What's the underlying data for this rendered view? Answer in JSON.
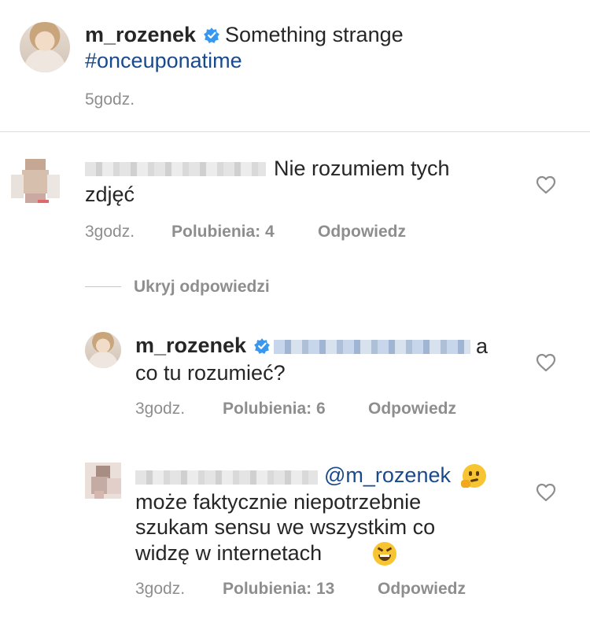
{
  "post": {
    "username": "m_rozenek",
    "caption": "Something strange",
    "hashtag": "#onceuponatime",
    "time": "5godz."
  },
  "comments": [
    {
      "text_line1": "Nie rozumiem tych",
      "text_line2": "zdjęć",
      "time": "3godz.",
      "likes": "Polubienia: 4",
      "reply": "Odpowiedz"
    }
  ],
  "replies_toggle": "Ukryj odpowiedzi",
  "replies": [
    {
      "username": "m_rozenek",
      "text_tail": "a",
      "text_line2": "co tu rozumieć?",
      "time": "3godz.",
      "likes": "Polubienia: 6",
      "reply": "Odpowiedz"
    },
    {
      "mention": "@m_rozenek",
      "emoji1": "thinking-face",
      "text_line2": "może faktycznie niepotrzebnie",
      "text_line3": "szukam sensu we wszystkim co",
      "text_line4": "widzę w internetach",
      "emoji2": "grinning-squinting-face",
      "time": "3godz.",
      "likes": "Polubienia: 13",
      "reply": "Odpowiedz"
    }
  ],
  "colors": {
    "text": "#262626",
    "muted": "#8e8e8e",
    "link": "#1a4a8e",
    "verified": "#3897f0"
  }
}
